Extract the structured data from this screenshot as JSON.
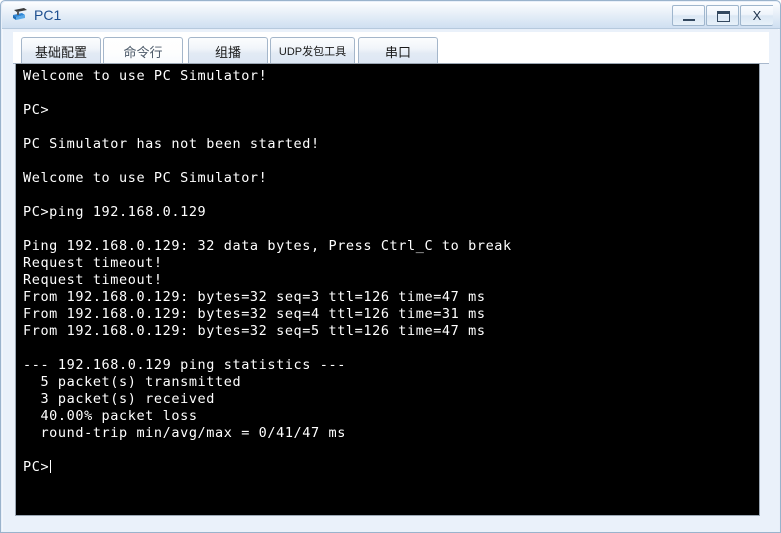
{
  "window": {
    "title": "PC1",
    "icon": "pc-device-icon",
    "controls": {
      "minimize_label": "–",
      "maximize_label": "❐",
      "close_label": "X"
    }
  },
  "tabs": [
    {
      "label": "基础配置",
      "selected": false,
      "name": "tab-basic-config"
    },
    {
      "label": "命令行",
      "selected": true,
      "name": "tab-command-line"
    },
    {
      "label": "组播",
      "selected": false,
      "name": "tab-multicast"
    },
    {
      "label": "UDP发包工具",
      "selected": false,
      "name": "tab-udp-tool",
      "small": true
    },
    {
      "label": "串口",
      "selected": false,
      "name": "tab-serial-port"
    }
  ],
  "terminal": {
    "prompt": "PC>",
    "lines": [
      "Welcome to use PC Simulator!",
      "",
      "PC>",
      "",
      "PC Simulator has not been started!",
      "",
      "Welcome to use PC Simulator!",
      "",
      "PC>ping 192.168.0.129",
      "",
      "Ping 192.168.0.129: 32 data bytes, Press Ctrl_C to break",
      "Request timeout!",
      "Request timeout!",
      "From 192.168.0.129: bytes=32 seq=3 ttl=126 time=47 ms",
      "From 192.168.0.129: bytes=32 seq=4 ttl=126 time=31 ms",
      "From 192.168.0.129: bytes=32 seq=5 ttl=126 time=47 ms",
      "",
      "--- 192.168.0.129 ping statistics ---",
      "  5 packet(s) transmitted",
      "  3 packet(s) received",
      "  40.00% packet loss",
      "  round-trip min/avg/max = 0/41/47 ms",
      ""
    ],
    "final_prompt": "PC>",
    "ping_summary": {
      "target_ip": "192.168.0.129",
      "data_bytes": 32,
      "break_key": "Ctrl_C",
      "packets_transmitted": 5,
      "packets_received": 3,
      "packet_loss_percent": "40.00%",
      "rtt_min_ms": 0,
      "rtt_avg_ms": 41,
      "rtt_max_ms": 47,
      "replies": [
        {
          "seq": 3,
          "bytes": 32,
          "ttl": 126,
          "time_ms": 47
        },
        {
          "seq": 4,
          "bytes": 32,
          "ttl": 126,
          "time_ms": 31
        },
        {
          "seq": 5,
          "bytes": 32,
          "ttl": 126,
          "time_ms": 47
        }
      ],
      "timeouts": 2
    }
  },
  "colors": {
    "terminal_bg": "#000000",
    "terminal_fg": "#ffffff",
    "title_accent": "#1d4e8f",
    "window_bg": "#eaf1fa"
  }
}
